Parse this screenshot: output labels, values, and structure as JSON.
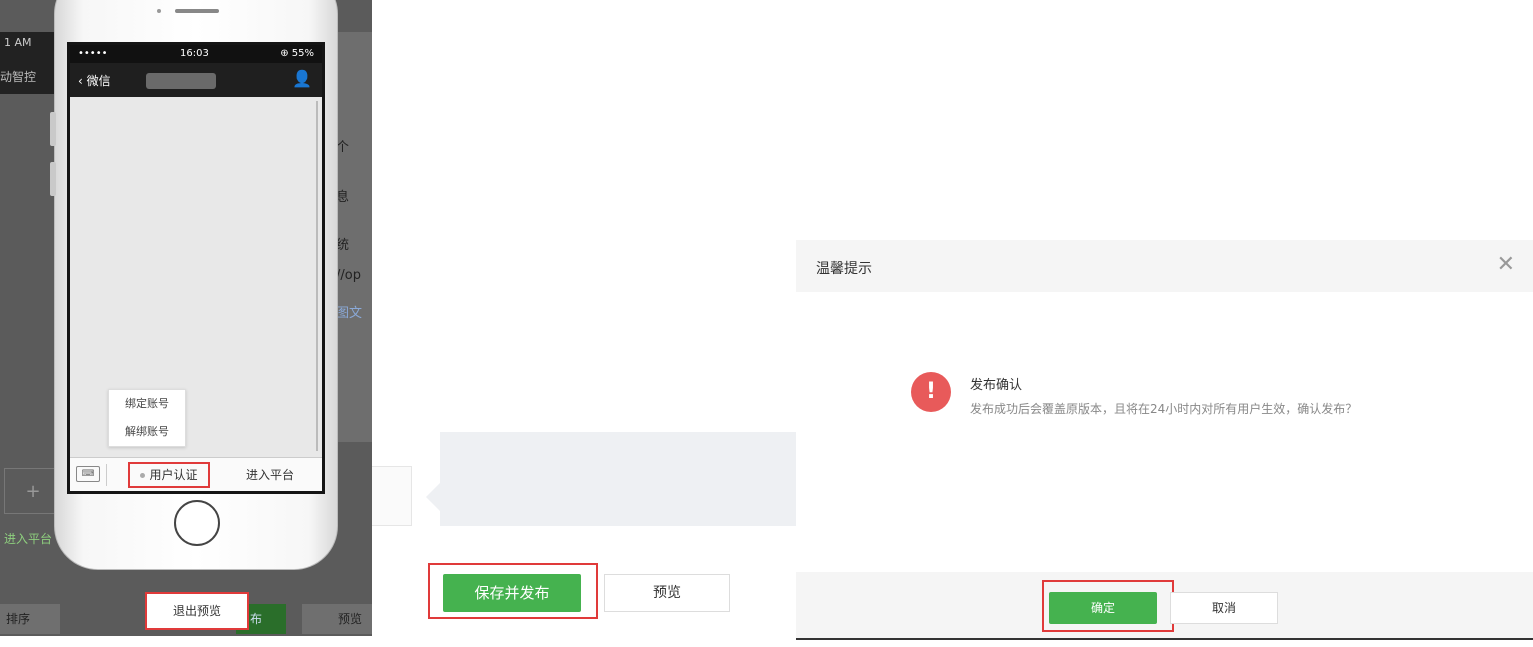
{
  "left_panel": {
    "bg_time": "1 AM",
    "bg_label": "动智控",
    "bg_side_texts": [
      "个",
      "息",
      "统",
      "//op",
      "图文"
    ],
    "bg_plus": "+",
    "bg_enter_platform": "进入平台",
    "bg_sort": "排序",
    "bg_publish": "布",
    "bg_preview": "预览",
    "status": {
      "signal": "•••••",
      "time": "16:03",
      "battery": "⊕ 55%"
    },
    "nav": {
      "back_label": "微信",
      "user_icon": "person-icon"
    },
    "submenu": [
      "绑定账号",
      "解绑账号"
    ],
    "keyboard_icon": "keyboard-icon",
    "tabs": {
      "auth": "用户认证",
      "enter": "进入平台"
    },
    "exit_preview": "退出预览"
  },
  "middle_panel": {
    "save_publish": "保存并发布",
    "preview": "预览"
  },
  "dialog": {
    "title": "温馨提示",
    "close_icon": "close-icon",
    "warn_icon": "!",
    "msg_title": "发布确认",
    "msg_body": "发布成功后会覆盖原版本，且将在24小时内对所有用户生效，确认发布？",
    "ok": "确定",
    "cancel": "取消"
  },
  "colors": {
    "accent_green": "#45b24f",
    "highlight_red": "#e03a3a",
    "warn_red": "#e85a5a"
  }
}
